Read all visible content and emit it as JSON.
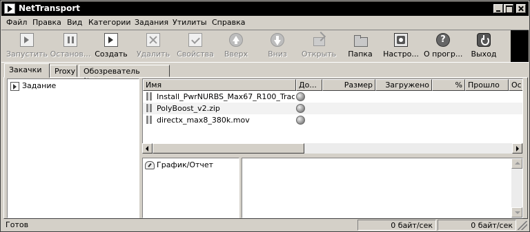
{
  "window": {
    "title": "NetTransport"
  },
  "menu": [
    "Файл",
    "Правка",
    "Вид",
    "Категории",
    "Задания",
    "Утилиты",
    "Справка"
  ],
  "toolbar": [
    {
      "label": "Запустить",
      "icon": "play-page-icon",
      "enabled": false
    },
    {
      "label": "Останов...",
      "icon": "pause-icon",
      "enabled": false
    },
    {
      "label": "Создать",
      "icon": "new-task-icon",
      "enabled": true
    },
    {
      "label": "Удалить",
      "icon": "delete-icon",
      "enabled": false
    },
    {
      "label": "Свойства",
      "icon": "properties-icon",
      "enabled": false
    },
    {
      "label": "Вверх",
      "icon": "arrow-up-icon",
      "enabled": false
    },
    {
      "label": "Вниз",
      "icon": "arrow-down-icon",
      "enabled": false
    },
    {
      "label": "Открыть",
      "icon": "open-icon",
      "enabled": false
    },
    {
      "label": "Папка",
      "icon": "folder-icon",
      "enabled": true
    },
    {
      "label": "Настро...",
      "icon": "settings-icon",
      "enabled": true
    },
    {
      "label": "О прогр...",
      "icon": "about-icon",
      "enabled": true
    },
    {
      "label": "Выход",
      "icon": "exit-icon",
      "enabled": true
    }
  ],
  "tabs": [
    "Закачки",
    "Proxy",
    "Обозреватель Сайтов"
  ],
  "tree": {
    "root": "Задание"
  },
  "list": {
    "columns": [
      "Имя",
      "До...",
      "Размер",
      "Загружено",
      "%",
      "Прошло",
      "Ос"
    ],
    "rows": [
      {
        "name": "Install_PwrNURBS_Max67_R100_Trac..."
      },
      {
        "name": "PolyBoost_v2.zip"
      },
      {
        "name": "directx_max8_380k.mov"
      }
    ]
  },
  "graph": {
    "label": "График/Отчет"
  },
  "about_glyph": "?",
  "status": {
    "text": "Готов",
    "speed1": "0 байт/сек",
    "speed2": "0 байт/сек"
  }
}
